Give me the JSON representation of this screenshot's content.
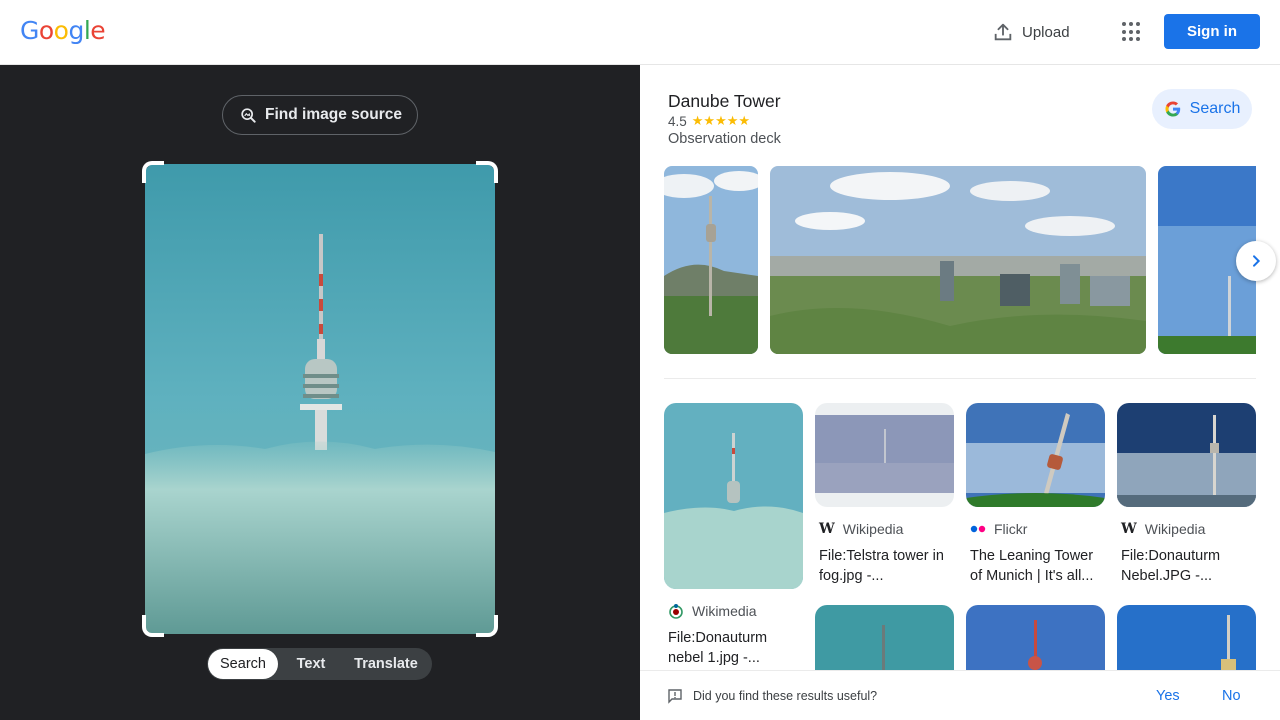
{
  "header": {
    "logo_letters": [
      {
        "char": "G",
        "color": "#4285F4"
      },
      {
        "char": "o",
        "color": "#EA4335"
      },
      {
        "char": "o",
        "color": "#FBBC05"
      },
      {
        "char": "g",
        "color": "#4285F4"
      },
      {
        "char": "l",
        "color": "#34A853"
      },
      {
        "char": "e",
        "color": "#EA4335"
      }
    ],
    "upload_label": "Upload",
    "signin_label": "Sign in"
  },
  "left_panel": {
    "find_source_label": "Find image source",
    "modes": [
      "Search",
      "Text",
      "Translate"
    ],
    "active_mode": "Search"
  },
  "knowledge_panel": {
    "title": "Danube Tower",
    "rating": "4.5",
    "stars": "★★★★★",
    "subtitle": "Observation deck",
    "search_label": "Search"
  },
  "results": [
    {
      "source": "Wikimedia",
      "title": "File:Donauturm nebel 1.jpg -..."
    },
    {
      "source": "Wikipedia",
      "title": "File:Telstra tower in fog.jpg -..."
    },
    {
      "source": "Flickr",
      "title": "The Leaning Tower of Munich | It's all..."
    },
    {
      "source": "Wikipedia",
      "title": "File:Donauturm Nebel.JPG -..."
    }
  ],
  "feedback": {
    "question": "Did you find these results useful?",
    "yes": "Yes",
    "no": "No"
  },
  "colors": {
    "accent": "#1a73e8",
    "dark_panel": "#202124",
    "star": "#fbbc04"
  }
}
